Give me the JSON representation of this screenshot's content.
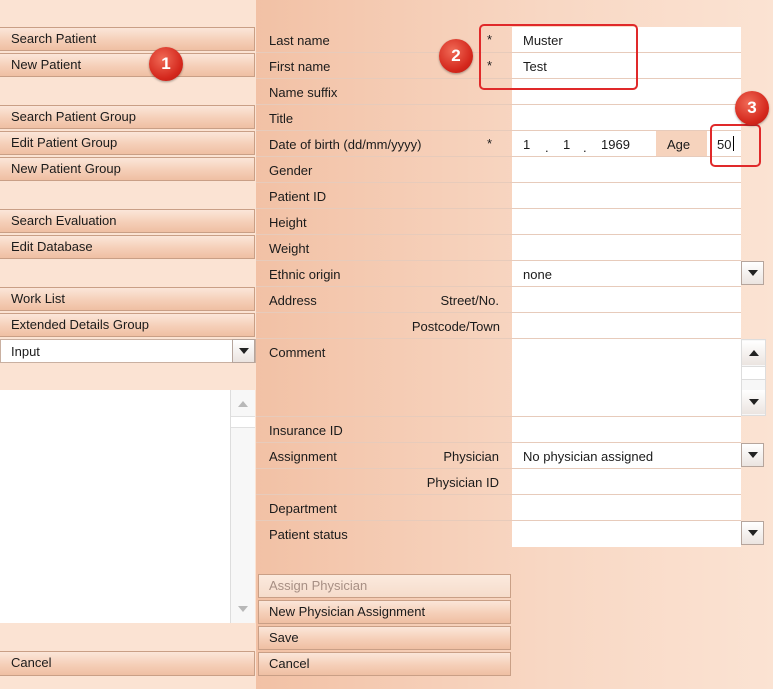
{
  "nav": {
    "search_patient": "Search Patient",
    "new_patient": "New Patient",
    "search_patient_group": "Search Patient Group",
    "edit_patient_group": "Edit Patient Group",
    "new_patient_group": "New Patient Group",
    "search_evaluation": "Search Evaluation",
    "edit_database": "Edit Database",
    "work_list": "Work List",
    "extended_details_group": "Extended Details Group",
    "input_select": "Input",
    "cancel": "Cancel"
  },
  "form": {
    "last_name_label": "Last name",
    "last_name_value": "Muster",
    "first_name_label": "First name",
    "first_name_value": "Test",
    "name_suffix_label": "Name suffix",
    "title_label": "Title",
    "dob_label": "Date of birth (dd/mm/yyyy)",
    "dob_day": "1",
    "dob_month": "1",
    "dob_year": "1969",
    "dob_sep": ".",
    "age_label": "Age",
    "age_value": "50",
    "gender_label": "Gender",
    "patient_id_label": "Patient ID",
    "height_label": "Height",
    "weight_label": "Weight",
    "ethnic_origin_label": "Ethnic origin",
    "ethnic_origin_value": "none",
    "address_label": "Address",
    "street_label": "Street/No.",
    "postcode_label": "Postcode/Town",
    "comment_label": "Comment",
    "insurance_id_label": "Insurance ID",
    "assignment_label": "Assignment",
    "physician_label": "Physician",
    "physician_value": "No physician assigned",
    "physician_id_label": "Physician ID",
    "department_label": "Department",
    "patient_status_label": "Patient status",
    "required_mark": "*"
  },
  "actions": {
    "assign_physician": "Assign Physician",
    "new_physician_assignment": "New Physician Assignment",
    "save": "Save",
    "cancel": "Cancel"
  },
  "annotations": {
    "one": "1",
    "two": "2",
    "three": "3"
  }
}
